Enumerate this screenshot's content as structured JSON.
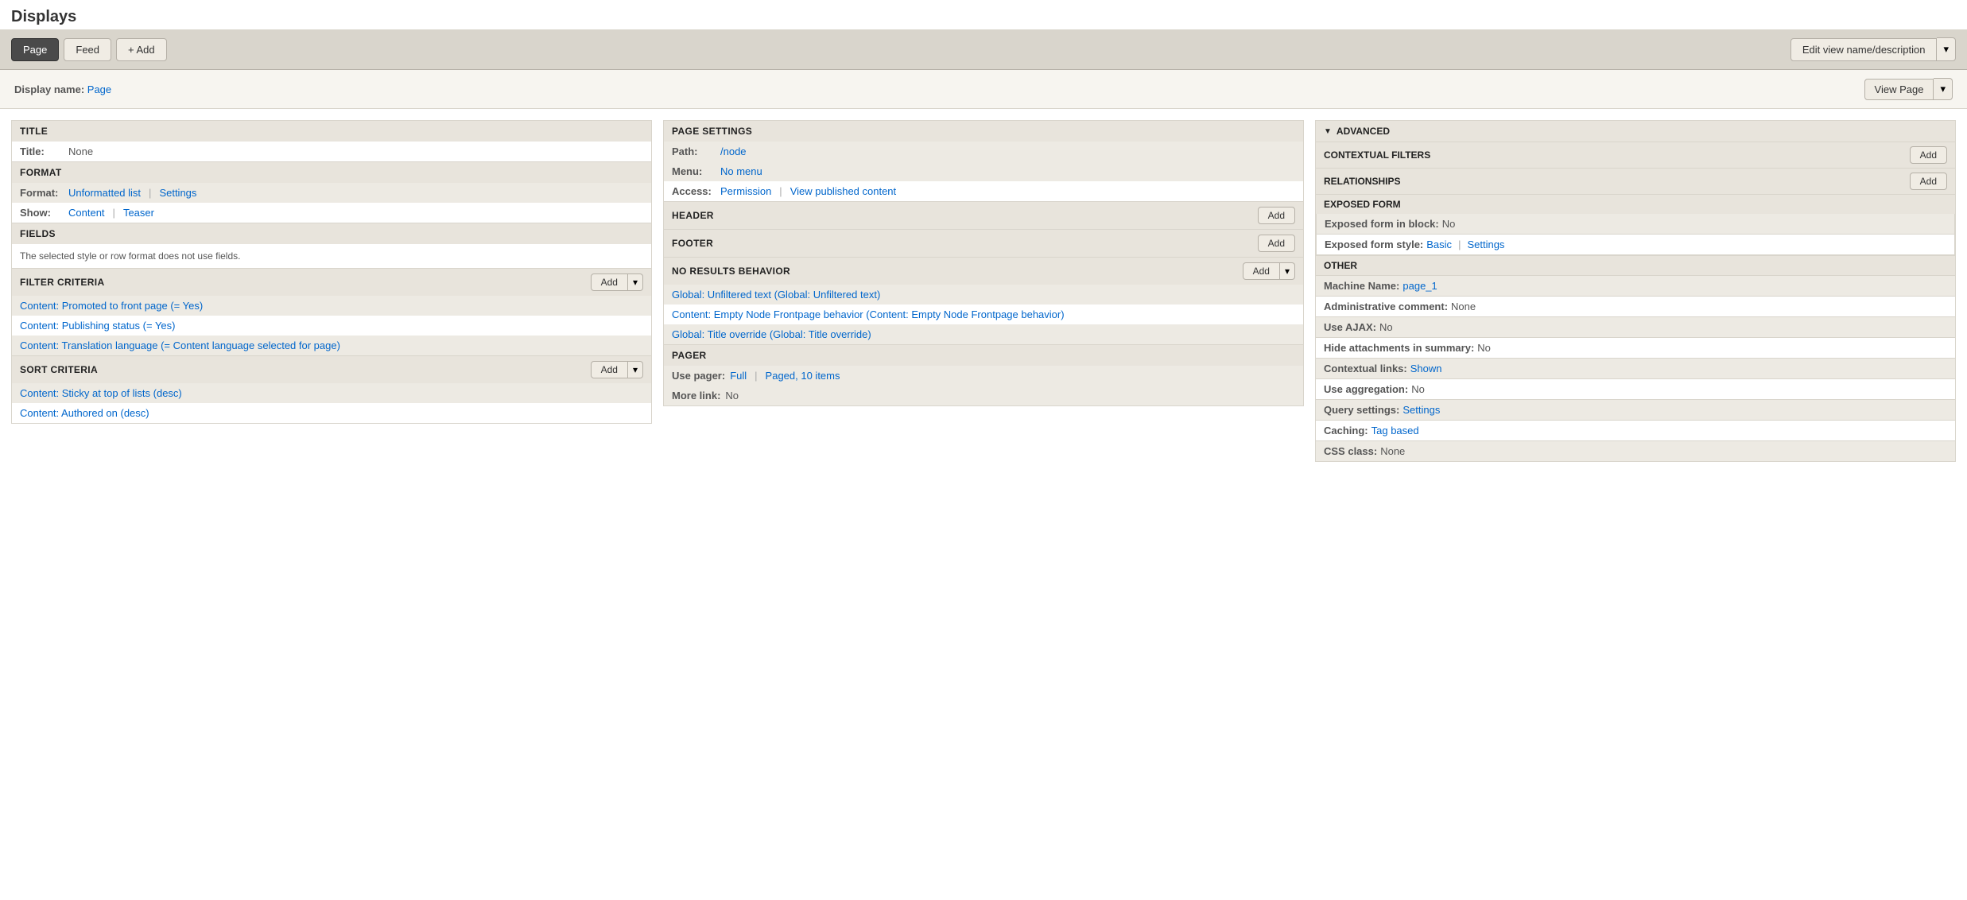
{
  "app": {
    "heading": "Displays"
  },
  "tabs": [
    {
      "label": "Page",
      "active": true
    },
    {
      "label": "Feed",
      "active": false
    }
  ],
  "add_tab_label": "+ Add",
  "edit_view_btn_label": "Edit view name/description",
  "display_name_label": "Display name:",
  "display_name_value": "Page",
  "view_page_btn_label": "View Page",
  "left_column": {
    "title_section": {
      "header": "TITLE",
      "title_label": "Title:",
      "title_value": "None"
    },
    "format_section": {
      "header": "FORMAT",
      "format_label": "Format:",
      "format_link": "Unformatted list",
      "settings_link": "Settings",
      "show_label": "Show:",
      "show_content_link": "Content",
      "show_teaser_link": "Teaser"
    },
    "fields_section": {
      "header": "FIELDS",
      "note": "The selected style or row format does not use fields."
    },
    "filter_criteria_section": {
      "header": "FILTER CRITERIA",
      "items": [
        "Content: Promoted to front page (= Yes)",
        "Content: Publishing status (= Yes)",
        "Content: Translation language (= Content language selected for page)"
      ]
    },
    "sort_criteria_section": {
      "header": "SORT CRITERIA",
      "items": [
        "Content: Sticky at top of lists (desc)",
        "Content: Authored on (desc)"
      ]
    }
  },
  "middle_column": {
    "page_settings_section": {
      "header": "PAGE SETTINGS",
      "path_label": "Path:",
      "path_value": "/node",
      "menu_label": "Menu:",
      "menu_value": "No menu",
      "access_label": "Access:",
      "access_link": "Permission",
      "access_view_link": "View published content"
    },
    "header_section": {
      "header": "HEADER"
    },
    "footer_section": {
      "header": "FOOTER"
    },
    "nrb_section": {
      "header": "NO RESULTS BEHAVIOR",
      "items": [
        "Global: Unfiltered text (Global: Unfiltered text)",
        "Content: Empty Node Frontpage behavior (Content: Empty Node Frontpage behavior)",
        "Global: Title override (Global: Title override)"
      ]
    },
    "pager_section": {
      "header": "PAGER",
      "use_pager_label": "Use pager:",
      "use_pager_value": "Full",
      "paged_value": "Paged, 10 items",
      "more_link_label": "More link:",
      "more_link_value": "No"
    }
  },
  "right_column": {
    "advanced_header": "ADVANCED",
    "contextual_filters": {
      "header": "CONTEXTUAL FILTERS"
    },
    "relationships": {
      "header": "RELATIONSHIPS"
    },
    "exposed_form": {
      "header": "EXPOSED FORM",
      "block_label": "Exposed form in block:",
      "block_value": "No",
      "style_label": "Exposed form style:",
      "style_link": "Basic",
      "style_settings_link": "Settings"
    },
    "other": {
      "header": "OTHER",
      "rows": [
        {
          "label": "Machine Name:",
          "value": "page_1",
          "is_link": true
        },
        {
          "label": "Administrative comment:",
          "value": "None",
          "is_link": false
        },
        {
          "label": "Use AJAX:",
          "value": "No",
          "is_link": false
        },
        {
          "label": "Hide attachments in summary:",
          "value": "No",
          "is_link": false
        },
        {
          "label": "Contextual links:",
          "value": "Shown",
          "is_link": true
        },
        {
          "label": "Use aggregation:",
          "value": "No",
          "is_link": false
        },
        {
          "label": "Query settings:",
          "value": "Settings",
          "is_link": true
        },
        {
          "label": "Caching:",
          "value": "Tag based",
          "is_link": true
        },
        {
          "label": "CSS class:",
          "value": "None",
          "is_link": false
        }
      ]
    }
  }
}
